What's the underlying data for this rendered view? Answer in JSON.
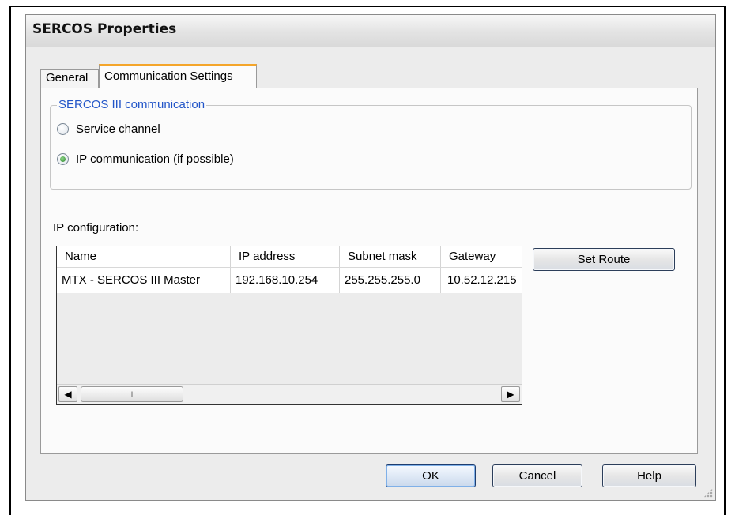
{
  "window": {
    "title": "SERCOS Properties"
  },
  "tabs": [
    {
      "label": "General",
      "active": false
    },
    {
      "label": "Communication Settings",
      "active": true
    }
  ],
  "sercos_group": {
    "legend": "SERCOS III communication",
    "options": [
      {
        "label": "Service channel",
        "selected": false
      },
      {
        "label": "IP communication (if possible)",
        "selected": true
      }
    ]
  },
  "ip_config": {
    "label": "IP configuration:",
    "columns": [
      "Name",
      "IP address",
      "Subnet mask",
      "Gateway"
    ],
    "rows": [
      [
        "MTX - SERCOS III Master",
        "192.168.10.254",
        "255.255.255.0",
        "10.52.12.215"
      ]
    ],
    "scroll_left_icon": "scroll-left-arrow",
    "scroll_right_icon": "scroll-right-arrow",
    "scroll_thumb_grip": "III"
  },
  "buttons": {
    "set_route": "Set Route",
    "ok": "OK",
    "cancel": "Cancel",
    "help": "Help"
  },
  "colors": {
    "accent_tab": "#f4a52a",
    "group_legend": "#2255c8",
    "radio_selected": "#2e8b2e"
  }
}
